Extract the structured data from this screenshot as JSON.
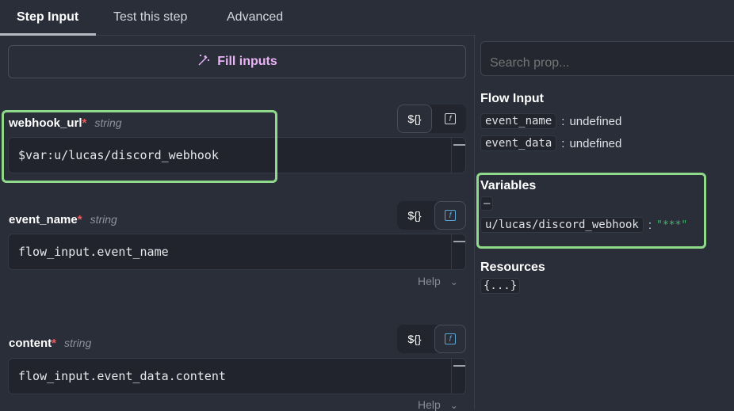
{
  "tabs": [
    {
      "label": "Step Input",
      "active": true
    },
    {
      "label": "Test this step"
    },
    {
      "label": "Advanced"
    }
  ],
  "fill_inputs": {
    "label": "Fill inputs",
    "icon": "magic-wand-icon"
  },
  "fields": [
    {
      "name": "webhook_url",
      "required_mark": "*",
      "type": "string",
      "value": "$var:u/lucas/discord_webhook",
      "dollar_label": "${}",
      "help": null
    },
    {
      "name": "event_name",
      "required_mark": "*",
      "type": "string",
      "value": "flow_input.event_name",
      "dollar_label": "${}",
      "help": "Help"
    },
    {
      "name": "content",
      "required_mark": "*",
      "type": "string",
      "value": "flow_input.event_data.content",
      "dollar_label": "${}",
      "help": "Help"
    }
  ],
  "fx_label": "f",
  "right": {
    "search_placeholder": "Search prop...",
    "flow_input": {
      "title": "Flow Input",
      "items": [
        {
          "key": "event_name",
          "value": "undefined"
        },
        {
          "key": "event_data",
          "value": "undefined"
        }
      ]
    },
    "variables": {
      "title": "Variables",
      "collapse": "–",
      "items": [
        {
          "key": "u/lucas/discord_webhook",
          "value": "\"***\""
        }
      ]
    },
    "resources": {
      "title": "Resources",
      "value": "{...}"
    }
  },
  "colors": {
    "highlight": "#8fd98a",
    "accent_purple": "#e9b3f5",
    "required": "#f05a5a",
    "secret_green": "#3fba6a"
  }
}
